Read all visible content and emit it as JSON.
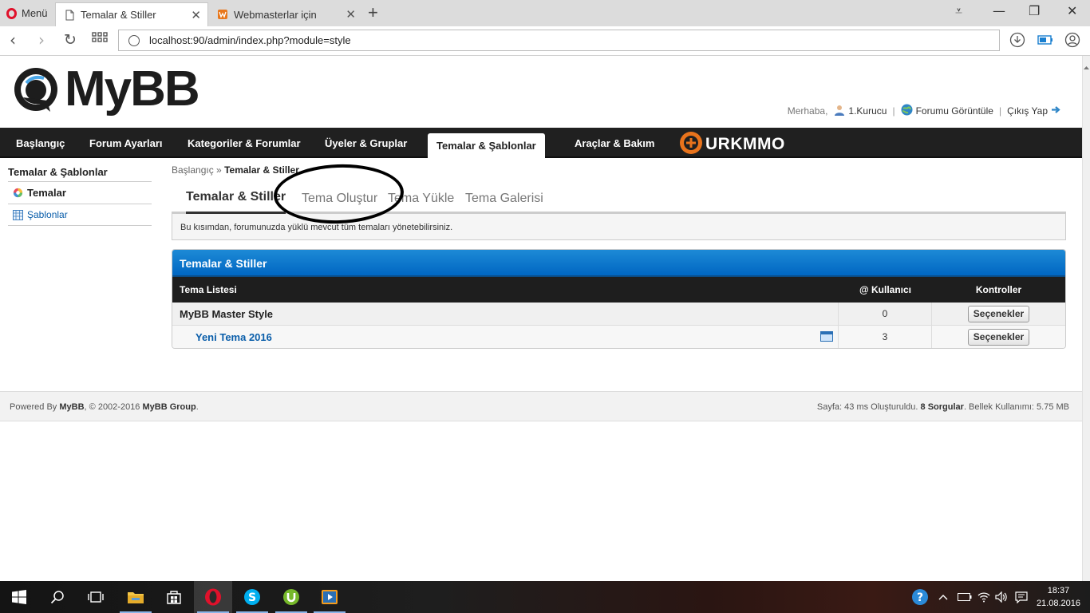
{
  "browser": {
    "menu_label": "Menü",
    "tabs": [
      {
        "title": "Temalar & Stiller"
      },
      {
        "title": "Webmasterlar için"
      }
    ],
    "url": "localhost:90/admin/index.php?module=style"
  },
  "header": {
    "logo_text": "MyBB",
    "greeting": "Merhaba,",
    "username": "1.Kurucu",
    "view_forum": "Forumu Görüntüle",
    "logout": "Çıkış Yap"
  },
  "menu": {
    "items": [
      {
        "label": "Başlangıç"
      },
      {
        "label": "Forum Ayarları"
      },
      {
        "label": "Kategoriler & Forumlar"
      },
      {
        "label": "Üyeler & Gruplar"
      },
      {
        "label": "Temalar & Şablonlar"
      },
      {
        "label": "Araçlar & Bakım"
      }
    ],
    "brand": "URKMMO"
  },
  "sidebar": {
    "title": "Temalar & Şablonlar",
    "items": [
      {
        "label": "Temalar"
      },
      {
        "label": "Şablonlar"
      }
    ]
  },
  "content": {
    "breadcrumb_root": "Başlangıç",
    "breadcrumb_sep": "»",
    "breadcrumb_current": "Temalar & Stiller",
    "tabs": [
      {
        "label": "Temalar & Stiller"
      },
      {
        "label": "Tema Oluştur"
      },
      {
        "label": "Tema Yükle"
      },
      {
        "label": "Tema Galerisi"
      }
    ],
    "description": "Bu kısımdan, forumunuzda yüklü mevcut tüm temaları yönetebilirsiniz.",
    "table": {
      "title": "Temalar & Stiller",
      "columns": [
        "Tema Listesi",
        "@ Kullanıcı",
        "Kontroller"
      ],
      "rows": [
        {
          "name": "MyBB Master Style",
          "users": "0",
          "action": "Seçenekler"
        },
        {
          "name": "Yeni Tema 2016",
          "users": "3",
          "action": "Seçenekler"
        }
      ]
    }
  },
  "footer": {
    "powered_prefix": "Powered By",
    "powered_mybb": "MyBB",
    "powered_mid": ", © 2002-2016",
    "powered_group": "MyBB Group",
    "powered_end": ".",
    "stats_prefix": "Sayfa: 43 ms Oluşturuldu.",
    "stats_queries": "8 Sorgular",
    "stats_suffix": ". Bellek Kullanımı: 5.75 MB"
  },
  "taskbar": {
    "time": "18:37",
    "date": "21.08.2016"
  },
  "colors": {
    "accent_blue": "#0066c2",
    "menu_dark": "#202020",
    "link_blue": "#0a5eaa",
    "opera_red": "#e0112b"
  }
}
